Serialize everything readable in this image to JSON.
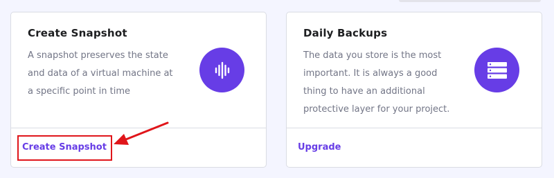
{
  "cards": [
    {
      "title": "Create Snapshot",
      "description": "A snapshot preserves the state and data of a virtual machine at a specific point in time",
      "action_label": "Create Snapshot",
      "icon": "audio-wave-icon"
    },
    {
      "title": "Daily Backups",
      "description": "The data you store is the most important. It is always a good thing to have an additional protective layer for your project.",
      "action_label": "Upgrade",
      "icon": "server-stack-icon"
    }
  ],
  "colors": {
    "accent": "#673de6",
    "annotation": "#e0151a",
    "background": "#f4f5ff"
  }
}
